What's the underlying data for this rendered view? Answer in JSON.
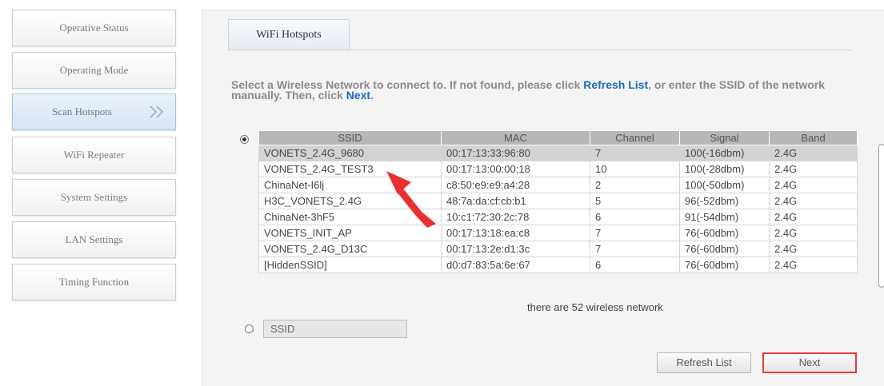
{
  "sidebar": {
    "items": [
      {
        "label": "Operative Status"
      },
      {
        "label": "Operating Mode"
      },
      {
        "label": "Scan Hotspots",
        "active": true
      },
      {
        "label": "WiFi Repeater"
      },
      {
        "label": "System Settings"
      },
      {
        "label": "LAN Settings"
      },
      {
        "label": "Timing Function"
      }
    ]
  },
  "main": {
    "tab_label": "WiFi Hotspots",
    "instructions": {
      "part1": "Select a Wireless Network to connect to. If not found, please click ",
      "refresh_link": "Refresh List",
      "part2": ", or enter the SSID of the network manually. Then, click ",
      "next_link": "Next",
      "part3": "."
    },
    "table": {
      "headers": [
        "SSID",
        "MAC",
        "Channel",
        "Signal",
        "Band"
      ],
      "rows": [
        [
          "VONETS_2.4G_9680",
          "00:17:13:33:96:80",
          "7",
          "100(-16dbm)",
          "2.4G"
        ],
        [
          "VONETS_2.4G_TEST3",
          "00:17:13:00:00:18",
          "10",
          "100(-28dbm)",
          "2.4G"
        ],
        [
          "ChinaNet-I6lj",
          "c8:50:e9:e9:a4:28",
          "2",
          "100(-50dbm)",
          "2.4G"
        ],
        [
          "H3C_VONETS_2.4G",
          "48:7a:da:cf:cb:b1",
          "5",
          "96(-52dbm)",
          "2.4G"
        ],
        [
          "ChinaNet-3hF5",
          "10:c1:72:30:2c:78",
          "6",
          "91(-54dbm)",
          "2.4G"
        ],
        [
          "VONETS_INIT_AP",
          "00:17:13:18:ea:c8",
          "7",
          "76(-60dbm)",
          "2.4G"
        ],
        [
          "VONETS_2.4G_D13C",
          "00:17:13:2e:d1:3c",
          "7",
          "76(-60dbm)",
          "2.4G"
        ],
        [
          "[HiddenSSID]",
          "d0:d7:83:5a:6e:67",
          "6",
          "76(-60dbm)",
          "2.4G"
        ]
      ]
    },
    "network_count": "there are 52 wireless network",
    "ssid_input": {
      "value": "SSID"
    },
    "buttons": {
      "refresh": "Refresh List",
      "next": "Next"
    }
  },
  "colors": {
    "link": "#1a6bbf",
    "highlight": "#e53a3a"
  }
}
